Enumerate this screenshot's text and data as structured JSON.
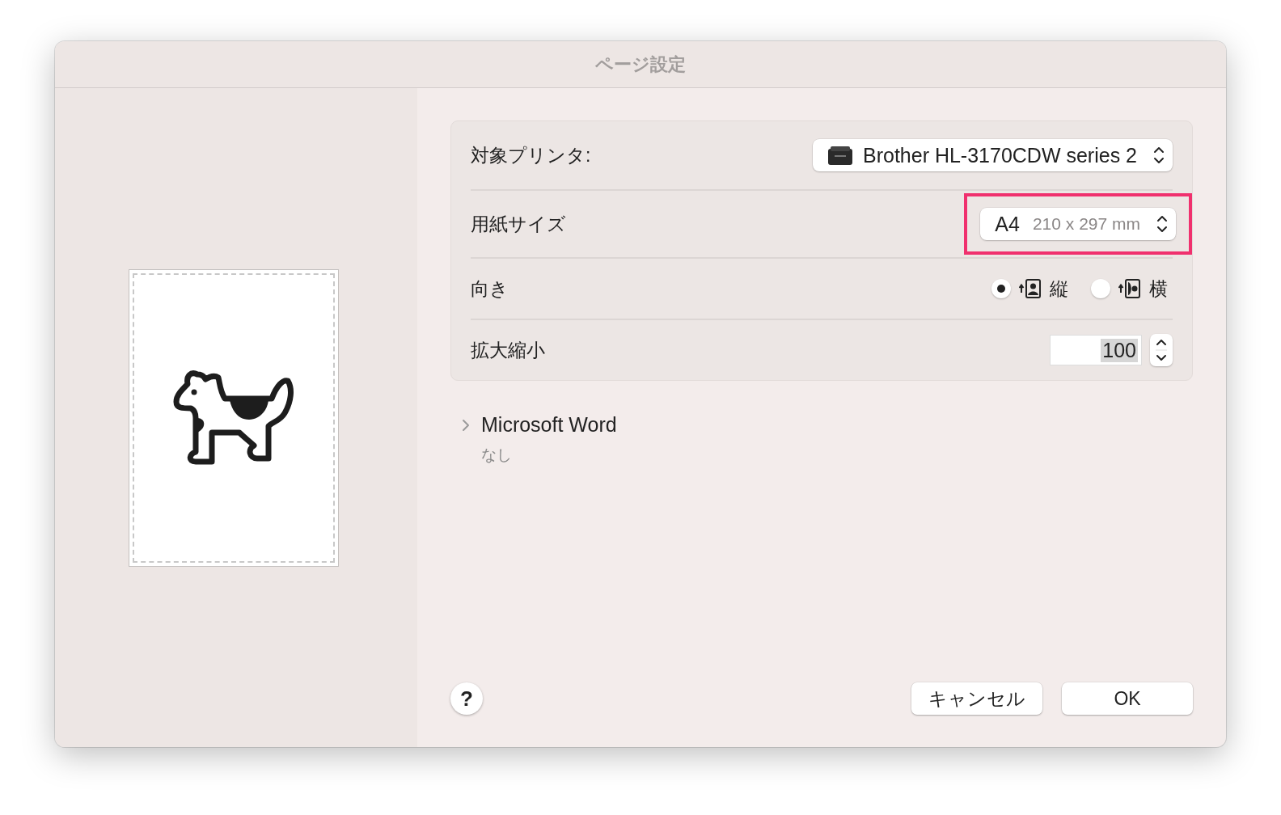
{
  "window": {
    "title": "ページ設定"
  },
  "settings": [
    {
      "kind": "printer_popup",
      "label": "対象プリンタ:",
      "value": "Brother HL-3170CDW series 2"
    },
    {
      "kind": "popup",
      "label": "用紙サイズ",
      "value": "A4",
      "detail": "210 x 297 mm",
      "highlighted": true
    },
    {
      "kind": "radio",
      "label": "向き",
      "options": [
        {
          "label": "縦",
          "selected": true
        },
        {
          "label": "横",
          "selected": false
        }
      ]
    },
    {
      "kind": "stepper",
      "label": "拡大縮小",
      "value": "100",
      "text_selected": true
    }
  ],
  "section": {
    "title": "Microsoft Word",
    "subtitle": "なし",
    "expanded": false
  },
  "help_button": "?",
  "buttons": [
    {
      "label": "キャンセル"
    },
    {
      "label": "OK"
    }
  ]
}
